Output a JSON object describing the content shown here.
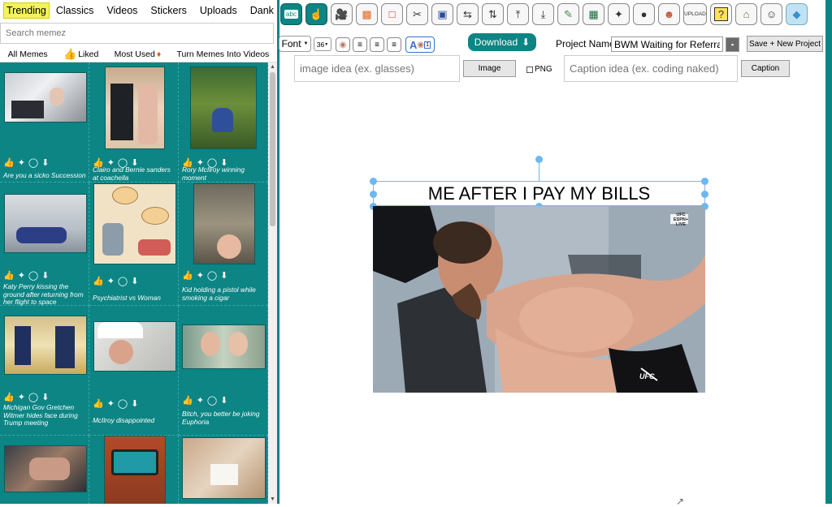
{
  "tabs": [
    "Trending",
    "Classics",
    "Videos",
    "Stickers",
    "Uploads",
    "Dank Bank"
  ],
  "search": {
    "placeholder": "Search memez"
  },
  "subnav": {
    "all": "All Memes",
    "liked": "Liked",
    "most_used": "Most Used",
    "turn_into_videos": "Turn Memes Into Videos"
  },
  "memes": [
    {
      "caption": "Are you a sicko Succession"
    },
    {
      "caption": "Clairo and Bernie sanders at coachella"
    },
    {
      "caption": "Rory McIlroy winning moment"
    },
    {
      "caption": "Katy Perry kissing the ground after returning from her flight to space"
    },
    {
      "caption": "Psychiatrist vs Woman"
    },
    {
      "caption": "Kid holding a pistol while smoking a cigar"
    },
    {
      "caption": "Michigan Gov Gretchen Witmer hides face during Trump meeting"
    },
    {
      "caption": "McIlroy disappointed"
    },
    {
      "caption": "Bitch, you better be joking Euphoria"
    },
    {
      "caption": ""
    },
    {
      "caption": ""
    },
    {
      "caption": ""
    }
  ],
  "toolbar": {
    "icons": [
      "text-abc-icon",
      "hand-pointer-icon",
      "video-camera-icon",
      "image-search-icon",
      "crop-icon",
      "scissors-person-icon",
      "frame-icon",
      "swap-horizontal-icon",
      "swap-vertical-icon",
      "bring-front-icon",
      "send-back-icon",
      "paint-tool-icon",
      "picture-frame-icon",
      "magic-wand-icon",
      "dog-face-icon",
      "person-icon",
      "upload-icon",
      "help-icon",
      "house-icon",
      "avatar-face-icon",
      "eraser-icon"
    ],
    "upload_label": "UPLOAD",
    "help_label": "?",
    "abc_label": "abc"
  },
  "controls": {
    "font_label": "Font",
    "font_size": "36",
    "download_label": "Download",
    "project_name_label": "Project Name:",
    "project_name_value": "BWM Waiting for Referrals",
    "save_new_label": "Save + New Project",
    "image_placeholder": "image idea (ex. glasses)",
    "image_button": "Image",
    "png_label": "PNG",
    "caption_placeholder": "Caption idea (ex. coding naked)",
    "caption_button": "Caption"
  },
  "meme": {
    "caption_text": "ME AFTER I PAY MY BILLS",
    "broadcast_logo": "UFC ESPN+ LIVE",
    "shorts_logo": "UFC"
  },
  "colors": {
    "accent": "#0c8584",
    "highlight": "#f3f35a",
    "handle": "#6cb8f0"
  }
}
